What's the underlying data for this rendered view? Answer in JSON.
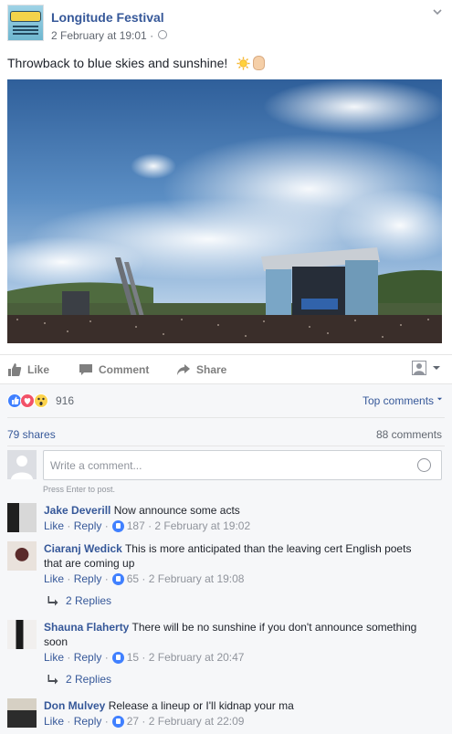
{
  "post": {
    "page_name": "Longitude Festival",
    "timestamp": "2 February at 19:01 ·",
    "text": "Throwback to blue skies and sunshine!",
    "emoji": [
      "sun-icon",
      "hand-icon"
    ]
  },
  "actions": {
    "like": "Like",
    "comment": "Comment",
    "share": "Share"
  },
  "stats": {
    "reaction_count": "916",
    "top_comments": "Top comments",
    "shares": "79 shares",
    "comments": "88 comments"
  },
  "composer": {
    "placeholder": "Write a comment...",
    "hint": "Press Enter to post."
  },
  "comments": [
    {
      "name": "Jake Deverill",
      "text": "Now announce some acts",
      "like": "Like",
      "reply": "Reply",
      "likes": "187",
      "time": "2 February at 19:02"
    },
    {
      "name": "Ciaranj Wedick",
      "text": "This is more anticipated than the leaving cert English poets that are coming up",
      "like": "Like",
      "reply": "Reply",
      "likes": "65",
      "time": "2 February at 19:08",
      "replies": "2 Replies"
    },
    {
      "name": "Shauna Flaherty",
      "text": "There will be no sunshine if you don't announce something soon",
      "like": "Like",
      "reply": "Reply",
      "likes": "15",
      "time": "2 February at 20:47",
      "replies": "2 Replies"
    },
    {
      "name": "Don Mulvey",
      "text": "Release a lineup or I'll kidnap your ma",
      "like": "Like",
      "reply": "Reply",
      "likes": "27",
      "time": "2 February at 22:09"
    }
  ],
  "colors": {
    "link_blue": "#365899",
    "like_blue": "#4080ff",
    "meta_grey": "#90949c",
    "feedback_bg": "#f6f7f9"
  }
}
